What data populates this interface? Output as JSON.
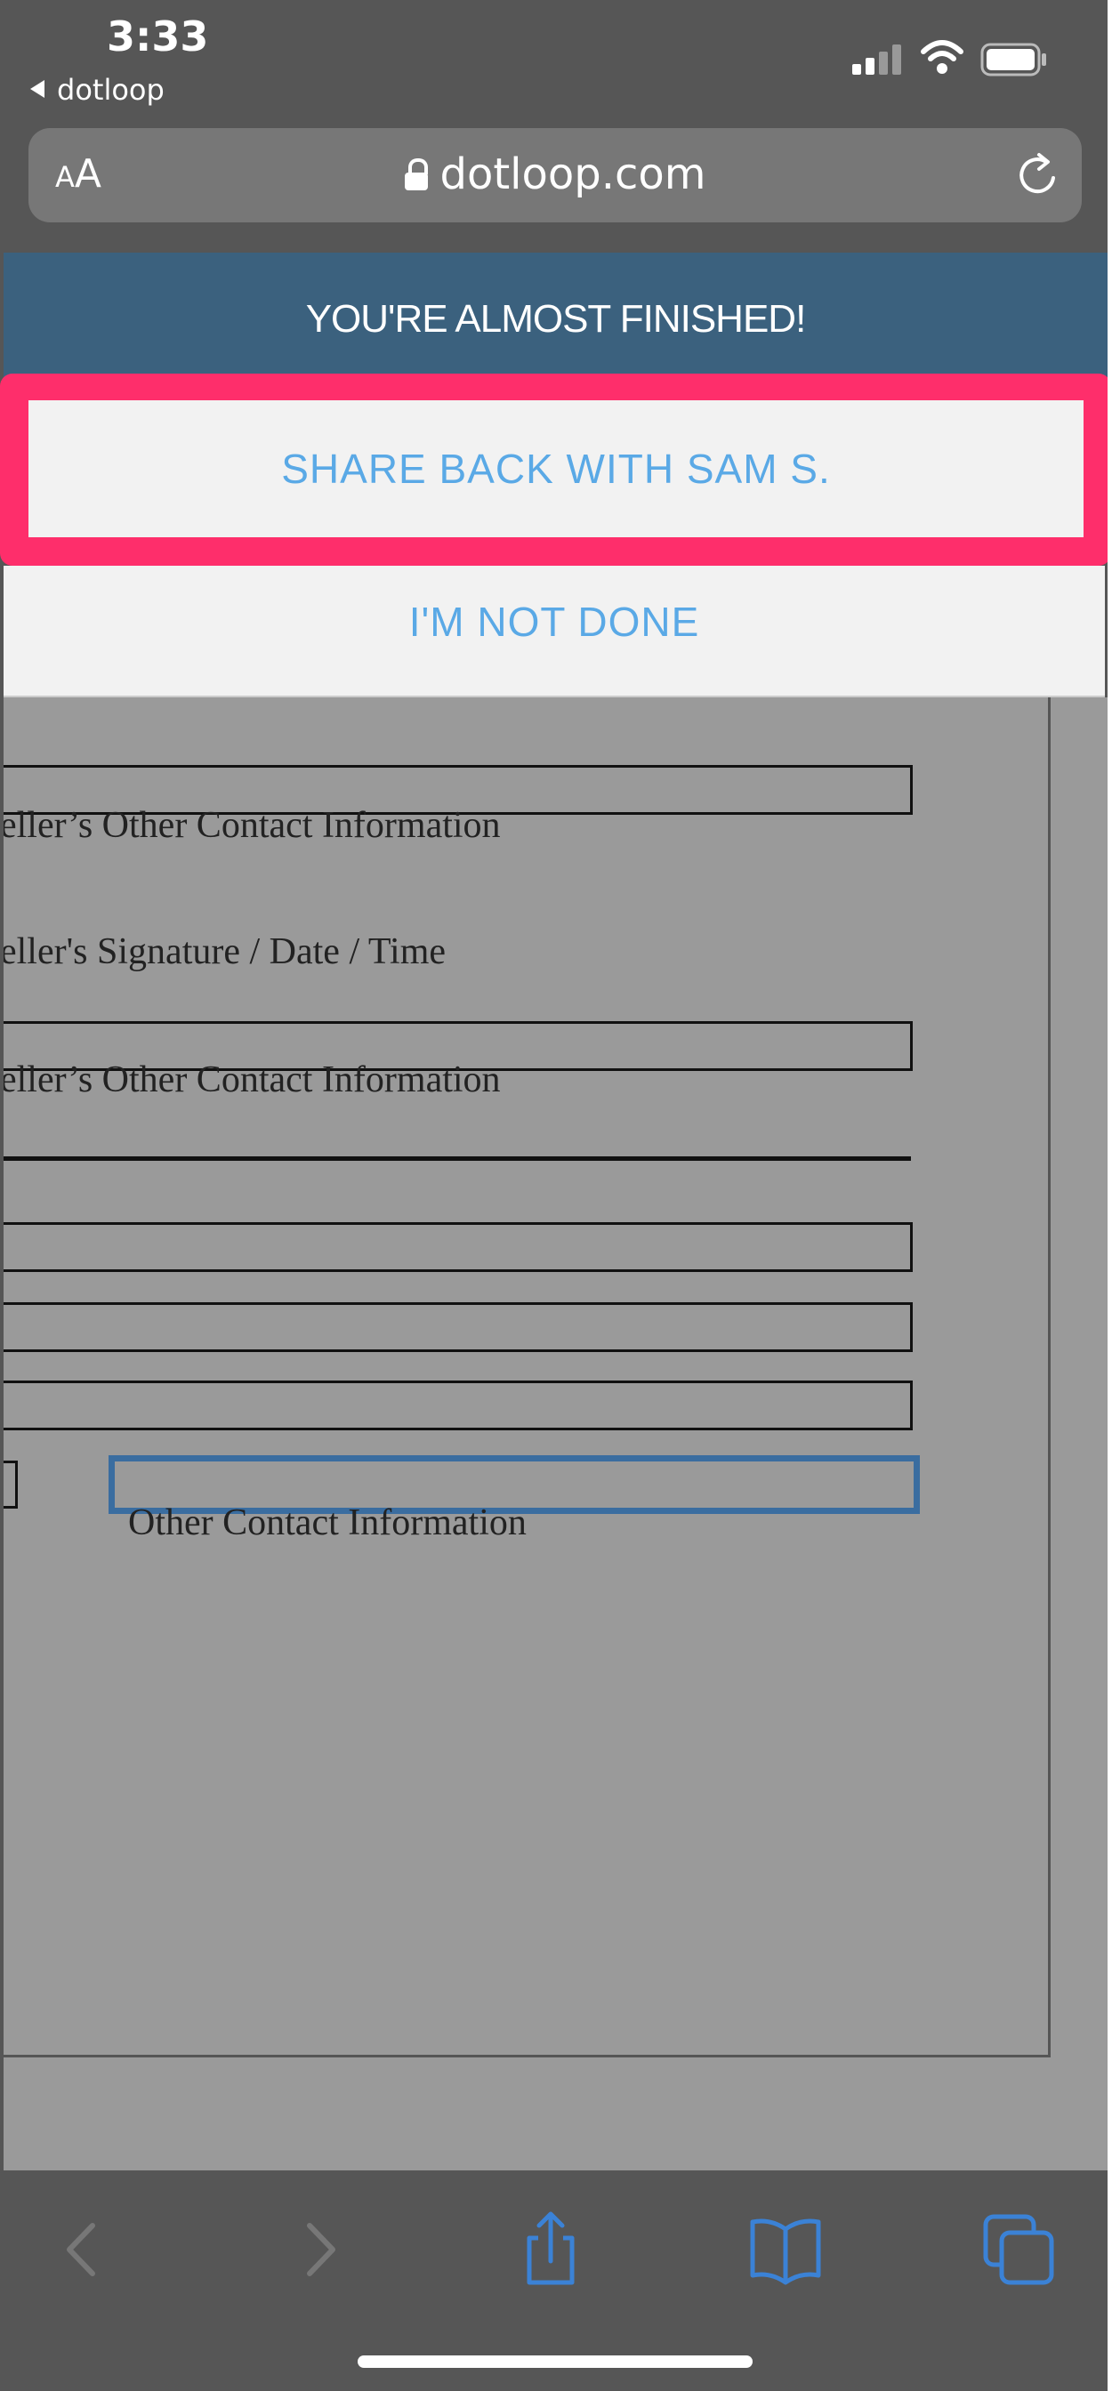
{
  "status_bar": {
    "time": "3:33",
    "back_label": "dotloop"
  },
  "browser": {
    "text_size_small": "A",
    "text_size_big": "A",
    "url": "dotloop.com"
  },
  "banner": {
    "title": "YOU'RE ALMOST FINISHED!"
  },
  "actions": {
    "share_label": "SHARE BACK WITH SAM S.",
    "not_done_label": "I'M NOT DONE"
  },
  "document": {
    "lines": [
      "eller’s Other Contact Information",
      "eller's Signature / Date / Time",
      "eller’s Other Contact Information",
      "Other Contact Information"
    ]
  },
  "colors": {
    "banner": "#3b617e",
    "highlight": "#fe2e6b",
    "link_text": "#5aa9e6",
    "active_field": "#3a6da0"
  },
  "toolbar_icons": [
    "back-icon",
    "forward-icon",
    "share-icon",
    "bookmarks-icon",
    "tabs-icon"
  ]
}
